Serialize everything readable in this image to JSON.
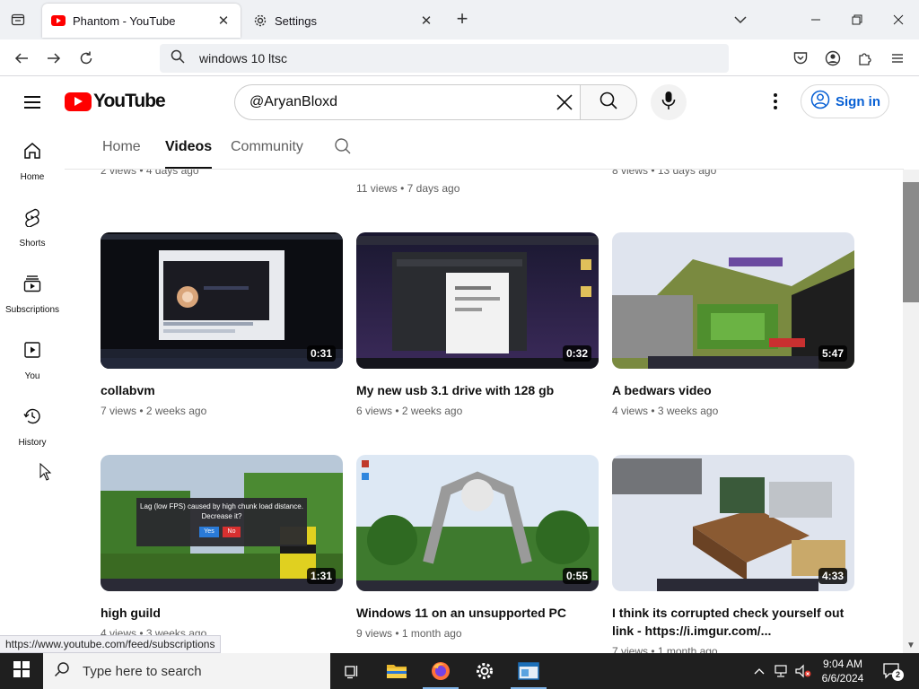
{
  "browser": {
    "tabs": [
      {
        "label": "Phantom - YouTube",
        "active": true
      },
      {
        "label": "Settings",
        "active": false
      }
    ],
    "url": "windows 10 ltsc",
    "status_url": "https://www.youtube.com/feed/subscriptions"
  },
  "youtube": {
    "logo": "YouTube",
    "search_query": "@AryanBloxd",
    "signin_label": "Sign in",
    "guide": [
      {
        "label": "Home",
        "icon": "home-icon"
      },
      {
        "label": "Shorts",
        "icon": "shorts-icon"
      },
      {
        "label": "Subscriptions",
        "icon": "subscriptions-icon"
      },
      {
        "label": "You",
        "icon": "you-icon"
      },
      {
        "label": "History",
        "icon": "history-icon"
      }
    ],
    "channel_tabs": [
      {
        "label": "Home",
        "selected": false
      },
      {
        "label": "Videos",
        "selected": true
      },
      {
        "label": "Community",
        "selected": false
      }
    ],
    "partial_row": [
      {
        "title": "",
        "meta": "2 views • 4 days ago"
      },
      {
        "title": "",
        "meta": "11 views • 7 days ago"
      },
      {
        "title": "",
        "meta": "8 views • 13 days ago"
      }
    ],
    "videos": [
      {
        "title": "collabvm",
        "meta": "7 views • 2 weeks ago",
        "duration": "0:31",
        "thumb": "desktop-screen"
      },
      {
        "title": "My new usb 3.1 drive with 128 gb",
        "meta": "6 views • 2 weeks ago",
        "duration": "0:32",
        "thumb": "dark-desktop"
      },
      {
        "title": "A bedwars video",
        "meta": "4 views • 3 weeks ago",
        "duration": "5:47",
        "thumb": "minecraft-sky"
      },
      {
        "title": "high guild",
        "meta": "4 views • 3 weeks ago",
        "duration": "1:31",
        "thumb": "minecraft-dialog"
      },
      {
        "title": "Windows 11 on an unsupported PC",
        "meta": "9 views • 1 month ago",
        "duration": "0:55",
        "thumb": "minecraft-structure"
      },
      {
        "title": "I think its corrupted check yourself out link - https://i.imgur.com/...",
        "meta": "7 views • 1 month ago",
        "duration": "4:33",
        "thumb": "minecraft-blocks"
      }
    ],
    "dialog": {
      "text": "Lag (low FPS) caused by high chunk load distance. Decrease it?",
      "yes": "Yes",
      "no": "No"
    }
  },
  "taskbar": {
    "search_placeholder": "Type here to search",
    "time": "9:04 AM",
    "date": "6/6/2024",
    "notification_count": "2"
  },
  "colors": {
    "youtube_red": "#ff0000",
    "signin_blue": "#065fd4",
    "taskbar": "#1f1f1f"
  }
}
